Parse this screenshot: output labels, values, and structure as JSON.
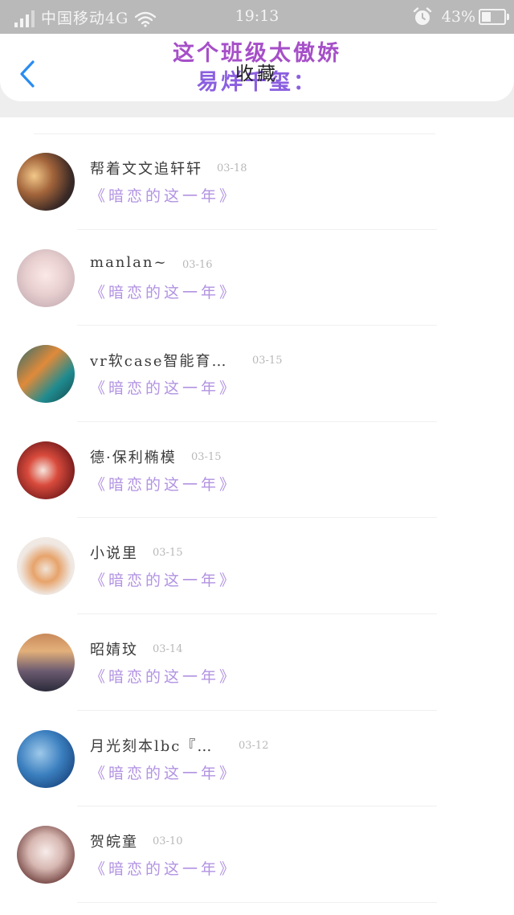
{
  "status_bar": {
    "carrier": "中国移动4G",
    "time": "19:13",
    "battery_percent": "43%",
    "battery_level": 0.43,
    "icons": [
      "signal-icon",
      "wifi-icon",
      "alarm-icon",
      "battery-icon"
    ]
  },
  "header": {
    "overlay_line1": "这个班级太傲娇",
    "overlay_line2": "易烊千玺：",
    "title": "收藏",
    "back_icon": "chevron-left-icon",
    "accent_color": "#2a8cf0"
  },
  "list": {
    "items": [
      {
        "name": "帮着文文追轩轩",
        "date": "03-18",
        "subtitle": "《暗恋的这一年》"
      },
      {
        "name": "manlan~",
        "date": "03-16",
        "subtitle": "《暗恋的这一年》"
      },
      {
        "name": "vr软case智能育…",
        "date": "03-15",
        "subtitle": "《暗恋的这一年》"
      },
      {
        "name": "德·保利椭模",
        "date": "03-15",
        "subtitle": "《暗恋的这一年》"
      },
      {
        "name": "小说里",
        "date": "03-15",
        "subtitle": "《暗恋的这一年》"
      },
      {
        "name": "昭婧玟",
        "date": "03-14",
        "subtitle": "《暗恋的这一年》"
      },
      {
        "name": "月光刻本lbc『…",
        "date": "03-12",
        "subtitle": "《暗恋的这一年》"
      },
      {
        "name": "贺皖童",
        "date": "03-10",
        "subtitle": "《暗恋的这一年》"
      }
    ]
  },
  "colors": {
    "subtitle": "#b293e2",
    "name": "#3b3b3b",
    "date": "#b8b8b8",
    "status_bar_bg": "#b9b9b9"
  }
}
